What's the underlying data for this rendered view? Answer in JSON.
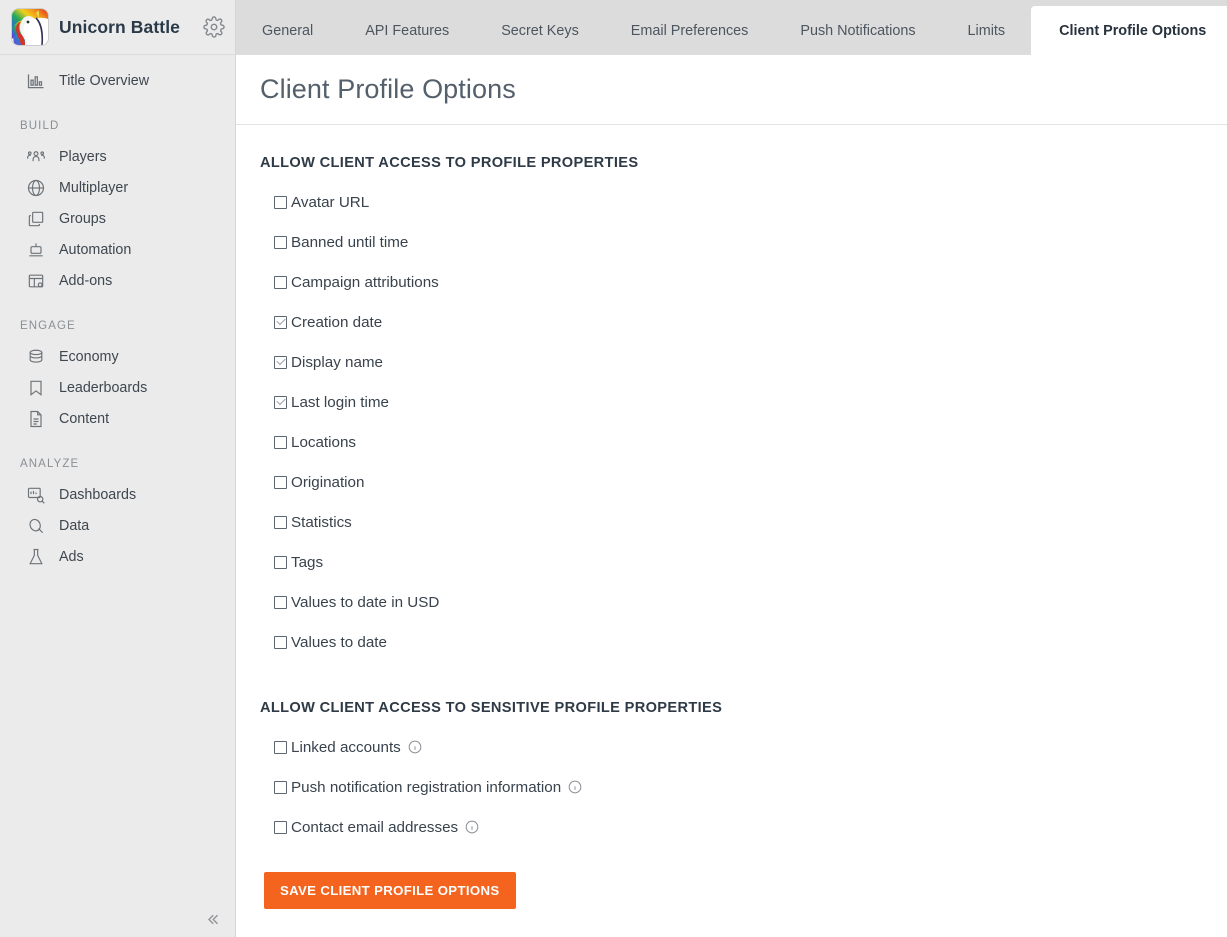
{
  "brand": {
    "title": "Unicorn Battle",
    "logo_icon": "unicorn-logo",
    "settings_icon": "gear-icon"
  },
  "sidebar": {
    "overview": {
      "label": "Title Overview",
      "icon": "bar-chart-icon"
    },
    "groups": [
      {
        "title": "BUILD",
        "items": [
          {
            "label": "Players",
            "icon": "players-icon"
          },
          {
            "label": "Multiplayer",
            "icon": "globe-icon"
          },
          {
            "label": "Groups",
            "icon": "layers-icon"
          },
          {
            "label": "Automation",
            "icon": "automation-icon"
          },
          {
            "label": "Add-ons",
            "icon": "addons-icon"
          }
        ]
      },
      {
        "title": "ENGAGE",
        "items": [
          {
            "label": "Economy",
            "icon": "coins-icon"
          },
          {
            "label": "Leaderboards",
            "icon": "bookmark-icon"
          },
          {
            "label": "Content",
            "icon": "document-icon"
          }
        ]
      },
      {
        "title": "ANALYZE",
        "items": [
          {
            "label": "Dashboards",
            "icon": "dashboard-icon"
          },
          {
            "label": "Data",
            "icon": "data-icon"
          },
          {
            "label": "Ads",
            "icon": "flask-icon"
          }
        ]
      }
    ],
    "collapse_icon": "chevron-double-left-icon"
  },
  "tabs": [
    {
      "label": "General",
      "active": false
    },
    {
      "label": "API Features",
      "active": false
    },
    {
      "label": "Secret Keys",
      "active": false
    },
    {
      "label": "Email Preferences",
      "active": false
    },
    {
      "label": "Push Notifications",
      "active": false
    },
    {
      "label": "Limits",
      "active": false
    },
    {
      "label": "Client Profile Options",
      "active": true
    }
  ],
  "page": {
    "title": "Client Profile Options"
  },
  "sections": [
    {
      "title": "ALLOW CLIENT ACCESS TO PROFILE PROPERTIES",
      "options": [
        {
          "label": "Avatar URL",
          "checked": false,
          "info": false
        },
        {
          "label": "Banned until time",
          "checked": false,
          "info": false
        },
        {
          "label": "Campaign attributions",
          "checked": false,
          "info": false
        },
        {
          "label": "Creation date",
          "checked": true,
          "info": false
        },
        {
          "label": "Display name",
          "checked": true,
          "info": false
        },
        {
          "label": "Last login time",
          "checked": true,
          "info": false
        },
        {
          "label": "Locations",
          "checked": false,
          "info": false
        },
        {
          "label": "Origination",
          "checked": false,
          "info": false
        },
        {
          "label": "Statistics",
          "checked": false,
          "info": false
        },
        {
          "label": "Tags",
          "checked": false,
          "info": false
        },
        {
          "label": "Values to date in USD",
          "checked": false,
          "info": false
        },
        {
          "label": "Values to date",
          "checked": false,
          "info": false
        }
      ]
    },
    {
      "title": "ALLOW CLIENT ACCESS TO SENSITIVE PROFILE PROPERTIES",
      "options": [
        {
          "label": "Linked accounts",
          "checked": false,
          "info": true
        },
        {
          "label": "Push notification registration information",
          "checked": false,
          "info": true
        },
        {
          "label": "Contact email addresses",
          "checked": false,
          "info": true
        }
      ]
    }
  ],
  "save_button": {
    "label": "SAVE CLIENT PROFILE OPTIONS",
    "color": "#f4641e"
  },
  "colors": {
    "sidebar_bg": "#ebebeb",
    "tabbar_bg": "#dcdcdc",
    "accent": "#f4641e",
    "text": "#39434d"
  }
}
